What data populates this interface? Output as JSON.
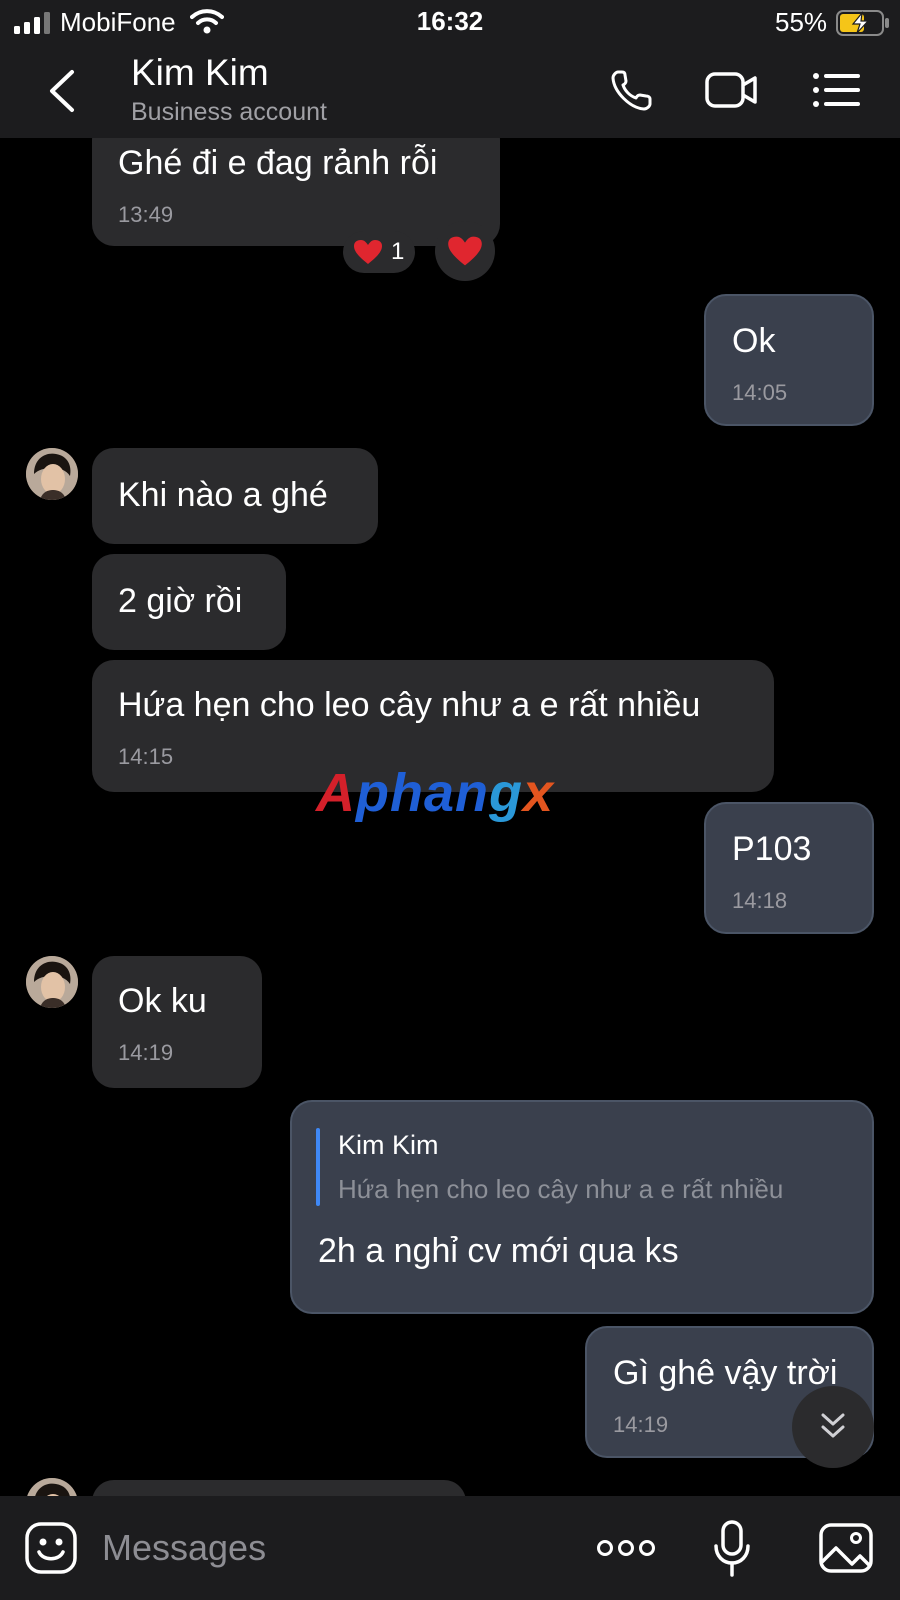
{
  "status_bar": {
    "carrier": "MobiFone",
    "time": "16:32",
    "battery": "55%"
  },
  "header": {
    "title": "Kim Kim",
    "subtitle": "Business account"
  },
  "messages": [
    {
      "id": "m1",
      "direction": "incoming",
      "text": "Ghé đi e đag rảnh rỗi",
      "time": "13:49",
      "reaction": {
        "emoji": "heart",
        "count": "1"
      }
    },
    {
      "id": "m2",
      "direction": "outgoing",
      "text": "Ok",
      "time": "14:05"
    },
    {
      "id": "m3",
      "direction": "incoming",
      "text": "Khi nào a ghé"
    },
    {
      "id": "m4",
      "direction": "incoming",
      "text": "2 giờ rồi"
    },
    {
      "id": "m5",
      "direction": "incoming",
      "text": "Hứa hẹn cho leo cây như a e rất nhiều",
      "time": "14:15"
    },
    {
      "id": "m6",
      "direction": "outgoing",
      "text": "P103",
      "time": "14:18"
    },
    {
      "id": "m7",
      "direction": "incoming",
      "text": "Ok ku",
      "time": "14:19"
    },
    {
      "id": "m8",
      "direction": "outgoing",
      "text": "2h a nghỉ cv mới qua ks",
      "quote": {
        "name": "Kim Kim",
        "text": "Hứa hẹn cho leo cây như a e rất nhiều"
      }
    },
    {
      "id": "m9",
      "direction": "outgoing",
      "text": "Gì ghê vậy trời",
      "time": "14:19"
    }
  ],
  "watermark": {
    "part1": "A",
    "part2": "phan",
    "part3": "g",
    "part4": "x"
  },
  "input": {
    "placeholder": "Messages"
  },
  "colors": {
    "incoming_bubble": "#2b2b2d",
    "outgoing_bubble": "#3a404d",
    "quote_bar": "#3f88f5",
    "background": "#000000"
  },
  "icons": [
    "back-icon",
    "phone-icon",
    "video-icon",
    "menu-icon",
    "heart-icon",
    "chevron-double-down-icon",
    "emoji-icon",
    "more-icon",
    "mic-icon",
    "gallery-icon"
  ]
}
